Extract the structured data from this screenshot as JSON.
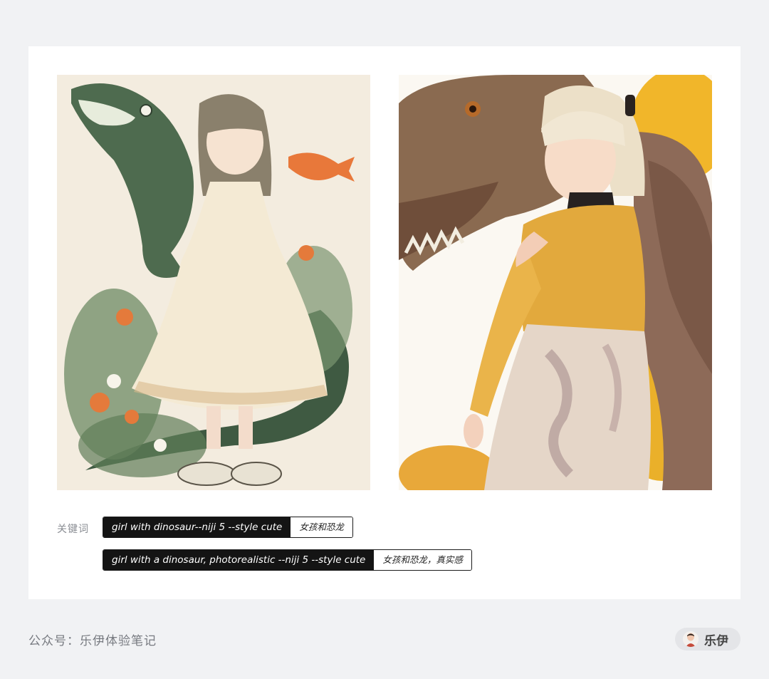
{
  "keywords_label": "关键词",
  "prompts": [
    {
      "en": "girl with dinosaur--niji 5 --style cute",
      "zh": "女孩和恐龙"
    },
    {
      "en": "girl with a dinosaur, photorealistic --niji 5 --style cute",
      "zh": "女孩和恐龙，真实感"
    }
  ],
  "footer": {
    "account": "公众号：乐伊体验笔记",
    "author": "乐伊"
  }
}
